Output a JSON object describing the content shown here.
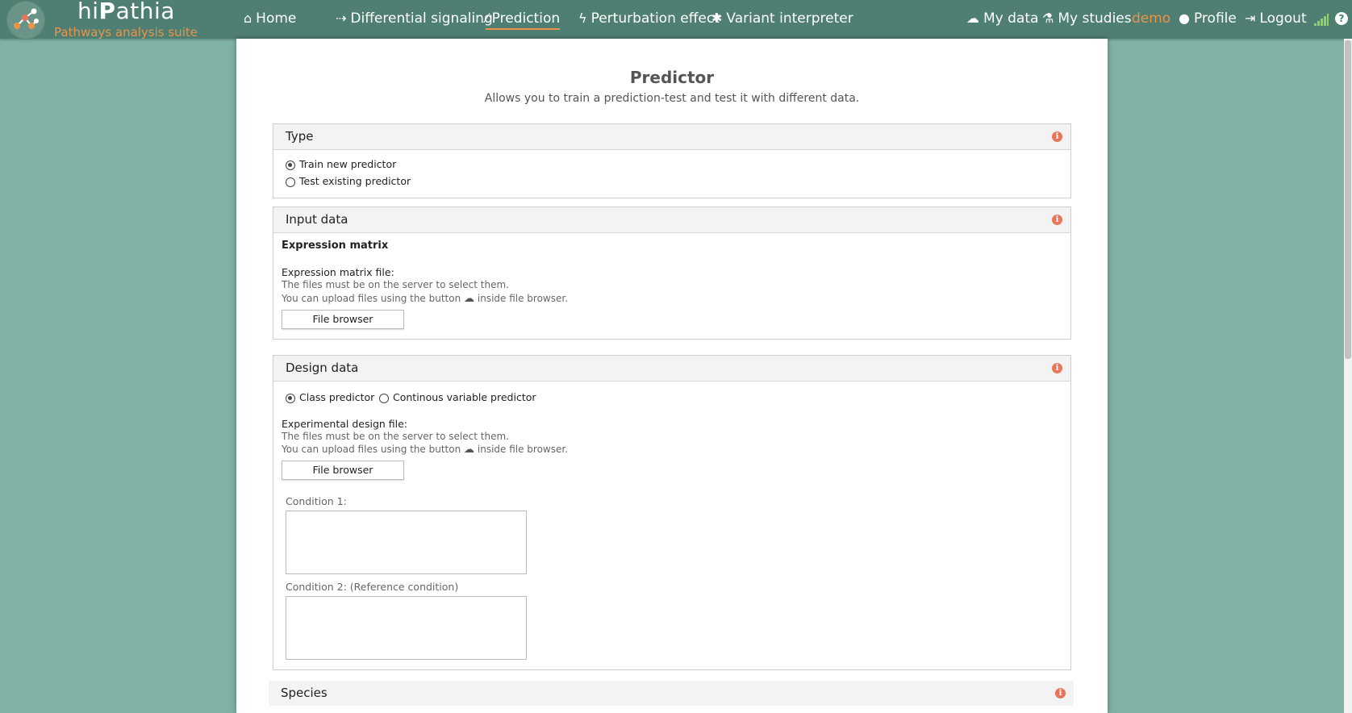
{
  "brand": {
    "name_pre": "hi",
    "name_bold": "P",
    "name_post": "athia",
    "tagline": "Pathways analysis suite"
  },
  "nav": {
    "home": "Home",
    "differential": "Differential signaling",
    "prediction": "Prediction",
    "perturbation": "Perturbation effect",
    "variant": "Variant interpreter",
    "mydata": "My data",
    "mystudies": "My studies",
    "user": "demo",
    "profile": "Profile",
    "logout": "Logout",
    "help": "?"
  },
  "page": {
    "title": "Predictor",
    "subtitle": "Allows you to train a prediction-test and test it with different data."
  },
  "type_panel": {
    "title": "Type",
    "options": [
      "Train new predictor",
      "Test existing predictor"
    ],
    "selected": "Train new predictor"
  },
  "input_panel": {
    "title": "Input data",
    "section": "Expression matrix",
    "file_label": "Expression matrix file:",
    "hint1": "The files must be on the server to select them.",
    "hint2_pre": "You can upload files using the button",
    "hint2_post": "inside file browser.",
    "button": "File browser"
  },
  "design_panel": {
    "title": "Design data",
    "options": [
      "Class predictor",
      "Continous variable predictor"
    ],
    "selected": "Class predictor",
    "file_label": "Experimental design file:",
    "hint1": "The files must be on the server to select them.",
    "hint2_pre": "You can upload files using the button",
    "hint2_post": "inside file browser.",
    "button": "File browser",
    "condition1": "Condition 1:",
    "condition2": "Condition 2: (Reference condition)"
  },
  "species_panel": {
    "title": "Species"
  },
  "colors": {
    "topbar": "#4f7e72",
    "background": "#7fb1a5",
    "accent": "#e8954a",
    "info": "#e8765a"
  },
  "icons": {
    "home": "home-icon",
    "differential": "usb-icon",
    "prediction": "magic-wand-icon",
    "perturbation": "bolt-icon",
    "variant": "asterisk-icon",
    "mydata": "cloud-icon",
    "mystudies": "flask-icon",
    "profile": "user-icon",
    "logout": "sign-out-icon",
    "signal": "signal-icon",
    "help": "question-icon",
    "info": "info-icon",
    "upload": "cloud-upload-icon"
  }
}
